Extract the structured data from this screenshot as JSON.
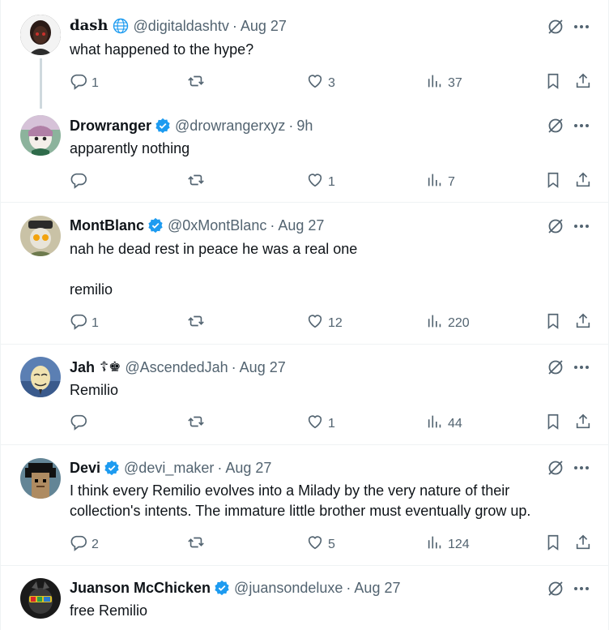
{
  "tweets": [
    {
      "name": "dash",
      "handle": "@digitaldashtv",
      "time": "Aug 27",
      "text": "what happened to the hype?",
      "replies": "1",
      "reposts": "",
      "likes": "3",
      "views": "37"
    },
    {
      "name": "Drowranger",
      "handle": "@drowrangerxyz",
      "time": "9h",
      "text": "apparently nothing",
      "replies": "",
      "reposts": "",
      "likes": "1",
      "views": "7"
    },
    {
      "name": "MontBlanc",
      "handle": "@0xMontBlanc",
      "time": "Aug 27",
      "text": "nah he dead rest in peace he was a real one\n\nremilio",
      "replies": "1",
      "reposts": "",
      "likes": "12",
      "views": "220"
    },
    {
      "name": "Jah",
      "name_badge": "☦♚",
      "handle": "@AscendedJah",
      "time": "Aug 27",
      "text": "Remilio",
      "replies": "",
      "reposts": "",
      "likes": "1",
      "views": "44"
    },
    {
      "name": "Devi",
      "handle": "@devi_maker",
      "time": "Aug 27",
      "text": "I think every Remilio evolves into a Milady by the very nature of their\ncollection's intents. The immature little brother must eventually grow up.",
      "replies": "2",
      "reposts": "",
      "likes": "5",
      "views": "124"
    },
    {
      "name": "Juanson McChicken",
      "handle": "@juansondeluxe",
      "time": "Aug 27",
      "text": "free Remilio"
    }
  ],
  "separator": "·",
  "icons": {
    "grok": "grok-icon",
    "more": "more-icon",
    "reply": "reply-icon",
    "repost": "repost-icon",
    "like": "like-icon",
    "views": "views-icon",
    "bookmark": "bookmark-icon",
    "share": "share-icon",
    "verified": "verified-badge-icon",
    "globe": "globe-icon"
  },
  "colors": {
    "text": "#0f1419",
    "secondary": "#536471",
    "verified": "#1d9bf0",
    "border": "#eff3f4",
    "thread_line": "#cfd9de"
  }
}
